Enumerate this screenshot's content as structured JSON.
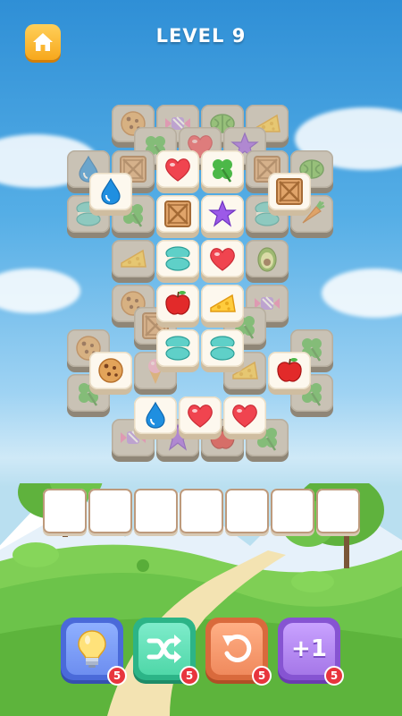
{
  "header": {
    "level_label": "LEVEL 9"
  },
  "tray": {
    "slot_count": 7
  },
  "boosters": [
    {
      "name": "hint",
      "icon": "lightbulb-icon",
      "count": "5",
      "color": "#6d8ef0"
    },
    {
      "name": "shuffle",
      "icon": "shuffle-icon",
      "count": "5",
      "color": "#4fd7a8"
    },
    {
      "name": "undo",
      "icon": "undo-icon",
      "count": "5",
      "color": "#f08a5d"
    },
    {
      "name": "add-slot",
      "icon": "plus-one-icon",
      "count": "5",
      "label": "+1",
      "color": "#a577e8"
    }
  ],
  "tile_icons": [
    "cookie-icon",
    "candy-icon",
    "melon-icon",
    "cheese-icon",
    "clover-icon",
    "heart-icon",
    "star-icon",
    "water-drop-icon",
    "crate-icon",
    "macaron-icon",
    "apple-icon",
    "avocado-icon",
    "ice-cream-icon",
    "carrot-icon"
  ],
  "colors": {
    "sky": "#3d97da",
    "grass": "#6cc34a",
    "tile_face": "#fdf8ee",
    "badge": "#e8353d"
  }
}
